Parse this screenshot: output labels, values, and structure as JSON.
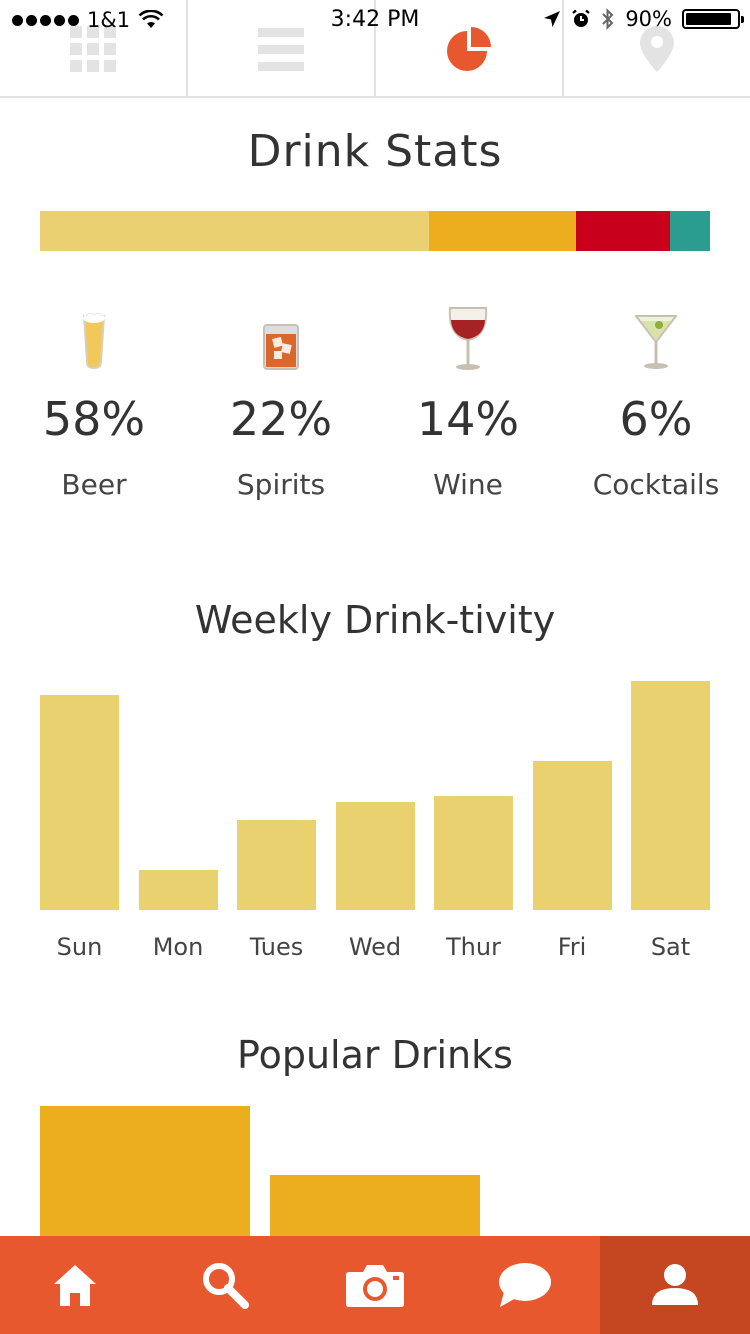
{
  "status_bar": {
    "carrier": "1&1",
    "time": "3:42 PM",
    "battery_text": "90%",
    "battery_level": 0.9
  },
  "top_tabs": {
    "active_index": 2,
    "tabs": [
      {
        "icon": "grid-icon"
      },
      {
        "icon": "list-icon"
      },
      {
        "icon": "pie-chart-icon"
      },
      {
        "icon": "map-pin-icon"
      }
    ]
  },
  "drink_stats": {
    "title": "Drink Stats",
    "categories": [
      {
        "label": "Beer",
        "percent_text": "58%",
        "share": 58,
        "color": "#ebd072",
        "icon": "beer-glass-icon"
      },
      {
        "label": "Spirits",
        "percent_text": "22%",
        "share": 22,
        "color": "#ecae1f",
        "icon": "whiskey-glass-icon"
      },
      {
        "label": "Wine",
        "percent_text": "14%",
        "share": 14,
        "color": "#c8001c",
        "icon": "wine-glass-icon"
      },
      {
        "label": "Cocktails",
        "percent_text": "6%",
        "share": 6,
        "color": "#2a9d8f",
        "icon": "martini-glass-icon"
      }
    ]
  },
  "weekly": {
    "title": "Weekly Drink-tivity",
    "bar_color": "#ead170"
  },
  "popular": {
    "title": "Popular Drinks",
    "bar_color": "#ecae1f"
  },
  "bottom_nav": {
    "active_index": 4,
    "items": [
      {
        "icon": "home-icon"
      },
      {
        "icon": "search-icon"
      },
      {
        "icon": "camera-icon"
      },
      {
        "icon": "chat-bubble-icon"
      },
      {
        "icon": "profile-icon"
      }
    ]
  },
  "chart_data": [
    {
      "type": "bar",
      "title": "Weekly Drink-tivity",
      "categories": [
        "Sun",
        "Mon",
        "Tues",
        "Wed",
        "Thur",
        "Fri",
        "Sat"
      ],
      "values": [
        215,
        40,
        90,
        108,
        114,
        149,
        229
      ],
      "ylim": [
        0,
        240
      ]
    },
    {
      "type": "bar",
      "title": "Popular Drinks",
      "categories": [
        "",
        ""
      ],
      "values": [
        120,
        58
      ],
      "ylim": [
        0,
        125
      ]
    }
  ]
}
